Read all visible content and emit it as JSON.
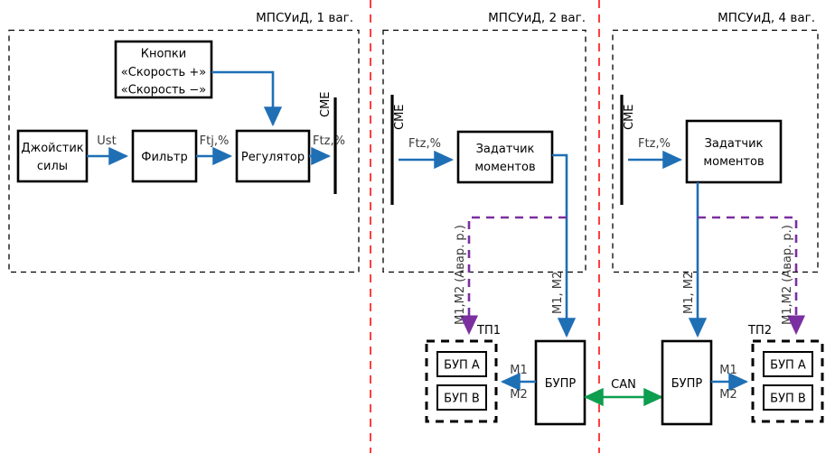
{
  "diagram": {
    "title_hidden": "",
    "panels": [
      {
        "id": "panel-1",
        "label": "МПСУиД, 1 ваг."
      },
      {
        "id": "panel-2",
        "label": "МПСУиД, 2 ваг."
      },
      {
        "id": "panel-3",
        "label": "МПСУиД, 4 ваг."
      }
    ],
    "blocks": {
      "joystick": {
        "line1": "Джойстик",
        "line2": "силы"
      },
      "buttons": {
        "line1": "Кнопки",
        "line2": "«Скорость +»",
        "line3": "«Скорость −»"
      },
      "filter": {
        "label": "Фильтр"
      },
      "regulator": {
        "label": "Регулятор"
      },
      "setpoint2": {
        "line1": "Задатчик",
        "line2": "моментов"
      },
      "setpoint4": {
        "line1": "Задатчик",
        "line2": "моментов"
      },
      "bupr_left": {
        "label": "БУПР"
      },
      "bupr_right": {
        "label": "БУПР"
      },
      "tp1": {
        "title": "ТП1",
        "bup_a": "БУП А",
        "bup_b": "БУП В"
      },
      "tp2": {
        "title": "ТП2",
        "bup_a": "БУП А",
        "bup_b": "БУП В"
      }
    },
    "bars": [
      {
        "id": "sme-bar-1",
        "label": "СМЕ"
      },
      {
        "id": "sme-bar-2",
        "label": "СМЕ"
      },
      {
        "id": "sme-bar-3",
        "label": "СМЕ"
      }
    ],
    "signals": {
      "ust": "Ust",
      "ftj": "Ftj,%",
      "ftz_1": "Ftz,%",
      "ftz_2": "Ftz,%",
      "ftz_3": "Ftz,%",
      "m1m2_blue_left": "M1, M2",
      "m1m2_blue_right": "M1, M2",
      "m1m2_avar_left": "M1,M2 (Авар. р.)",
      "m1m2_avar_right": "M1,M2 (Авар. р.)",
      "m1_left": "M1",
      "m2_left": "M2",
      "m1_right": "M1",
      "m2_right": "M2",
      "can": "CAN"
    },
    "colors": {
      "wire_blue": "#1f6fb5",
      "wire_purple": "#7b2fa0",
      "wire_green": "#0d9e4f",
      "divider_red": "#ff2a2a",
      "block_stroke": "#000000",
      "background": "#ffffff"
    }
  }
}
